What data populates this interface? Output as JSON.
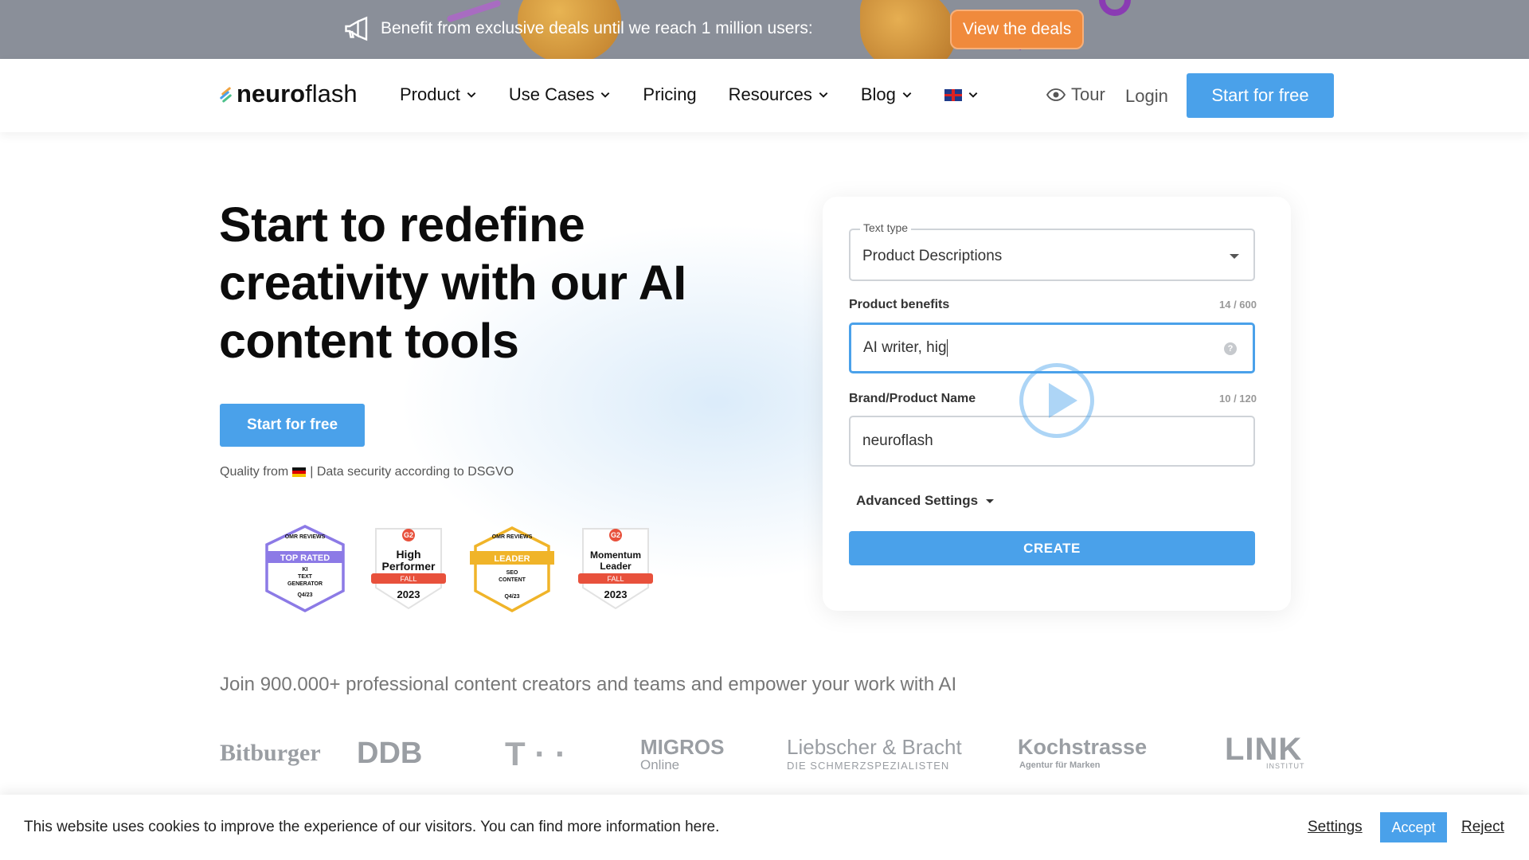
{
  "promo": {
    "icon": "megaphone-icon",
    "text": "Benefit from exclusive deals until we reach 1 million users:",
    "button": "View the deals",
    "button_color": "#f08a3c"
  },
  "header": {
    "logo_bold": "neuro",
    "logo_light": "flash",
    "nav": [
      "Product",
      "Use Cases",
      "Pricing",
      "Resources",
      "Blog"
    ],
    "tour": "Tour",
    "login": "Login",
    "cta": "Start for free",
    "accent": "#4aa1ea"
  },
  "hero": {
    "title": "Start to redefine creativity with our AI content tools",
    "cta": "Start for free",
    "quality_prefix": "Quality from",
    "quality_suffix": "| Data security according to DSGVO",
    "badges": [
      {
        "top": "OMR REVIEWS",
        "ribbon": "TOP RATED",
        "line1": "KI",
        "line2": "TEXT",
        "line3": "GENERATOR",
        "period": "Q4/23"
      },
      {
        "top": "G2",
        "title1": "High",
        "title2": "Performer",
        "ribbon": "FALL",
        "year": "2023"
      },
      {
        "top": "OMR REVIEWS",
        "ribbon": "LEADER",
        "line1": "SEO",
        "line2": "CONTENT",
        "period": "Q4/23"
      },
      {
        "top": "G2",
        "title1": "Momentum",
        "title2": "Leader",
        "ribbon": "FALL",
        "year": "2023"
      }
    ]
  },
  "demo": {
    "text_type_label": "Text type",
    "text_type_value": "Product Descriptions",
    "benefits_label": "Product benefits",
    "benefits_count": "14 / 600",
    "benefits_value": "AI writer, hig",
    "brand_label": "Brand/Product Name",
    "brand_count": "10 / 120",
    "brand_value": "neuroflash",
    "advanced": "Advanced Settings",
    "create": "CREATE"
  },
  "social": {
    "join": "Join 900.000+ professional content creators and teams and empower your work with AI",
    "logos": [
      "Bitburger",
      "DDB",
      "T · ·",
      "MIGROS",
      "Online",
      "Liebscher & Bracht",
      "DIE SCHMERZSPEZIALISTEN",
      "Kochstrasse",
      "Agentur für Marken",
      "LINK",
      "INSTITUT"
    ]
  },
  "cookie": {
    "text": "This website uses cookies to improve the experience of our visitors. You can find more information here.",
    "settings": "Settings",
    "accept": "Accept",
    "reject": "Reject"
  }
}
